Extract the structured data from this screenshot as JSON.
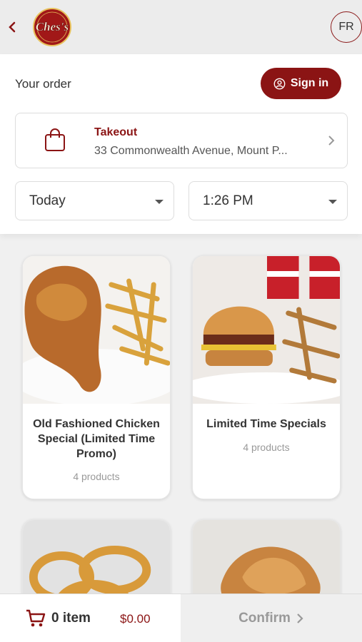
{
  "header": {
    "language": "FR",
    "brand": "Chess"
  },
  "order": {
    "heading": "Your order",
    "signin_label": "Sign in",
    "mode_title": "Takeout",
    "mode_address": "33 Commonwealth Avenue, Mount P...",
    "day": "Today",
    "time": "1:26 PM"
  },
  "categories": [
    {
      "title": "Old Fashioned Chicken Special (Limited Time Promo)",
      "count": "4 products"
    },
    {
      "title": "Limited Time Specials",
      "count": "4 products"
    },
    {
      "title": "",
      "count": ""
    },
    {
      "title": "",
      "count": ""
    }
  ],
  "cart": {
    "items": "0 item",
    "total": "$0.00",
    "confirm_label": "Confirm"
  },
  "colors": {
    "brand": "#8b1414",
    "background": "#f0f0f0"
  },
  "icons": [
    "back-chevron-icon",
    "user-icon",
    "bag-icon",
    "chevron-right-icon",
    "caret-down-icon",
    "cart-icon"
  ]
}
